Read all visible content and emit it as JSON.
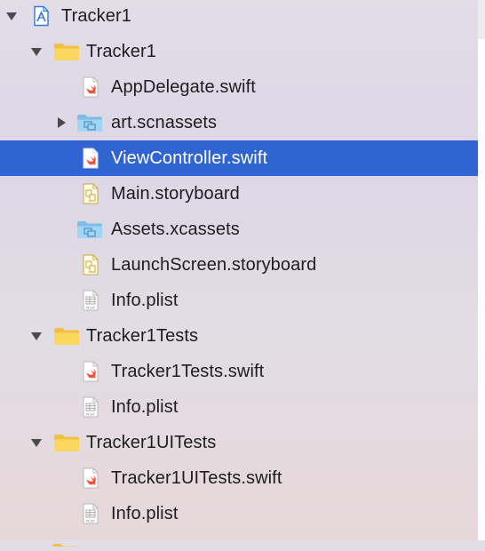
{
  "navigator": {
    "rows": [
      {
        "label": "Tracker1",
        "kind": "project",
        "expanded": true,
        "depth": 0
      },
      {
        "label": "Tracker1",
        "kind": "folder",
        "expanded": true,
        "depth": 1
      },
      {
        "label": "AppDelegate.swift",
        "kind": "swift",
        "depth": 2
      },
      {
        "label": "art.scnassets",
        "kind": "asset-folder",
        "expanded": false,
        "depth": 2
      },
      {
        "label": "ViewController.swift",
        "kind": "swift",
        "depth": 2,
        "selected": true
      },
      {
        "label": "Main.storyboard",
        "kind": "storyboard",
        "depth": 2
      },
      {
        "label": "Assets.xcassets",
        "kind": "asset-folder",
        "depth": 2
      },
      {
        "label": "LaunchScreen.storyboard",
        "kind": "storyboard",
        "depth": 2
      },
      {
        "label": "Info.plist",
        "kind": "plist",
        "depth": 2
      },
      {
        "label": "Tracker1Tests",
        "kind": "folder",
        "expanded": true,
        "depth": 1
      },
      {
        "label": "Tracker1Tests.swift",
        "kind": "swift",
        "depth": 2
      },
      {
        "label": "Info.plist",
        "kind": "plist",
        "depth": 2
      },
      {
        "label": "Tracker1UITests",
        "kind": "folder",
        "expanded": true,
        "depth": 1
      },
      {
        "label": "Tracker1UITests.swift",
        "kind": "swift",
        "depth": 2
      },
      {
        "label": "Info.plist",
        "kind": "plist",
        "depth": 2
      }
    ],
    "plist_badge": "PLIST"
  },
  "colors": {
    "selection": "#2f64d2",
    "folder": "#f7c948",
    "swift": "#f05138",
    "asset_folder": "#8cc8ee"
  }
}
